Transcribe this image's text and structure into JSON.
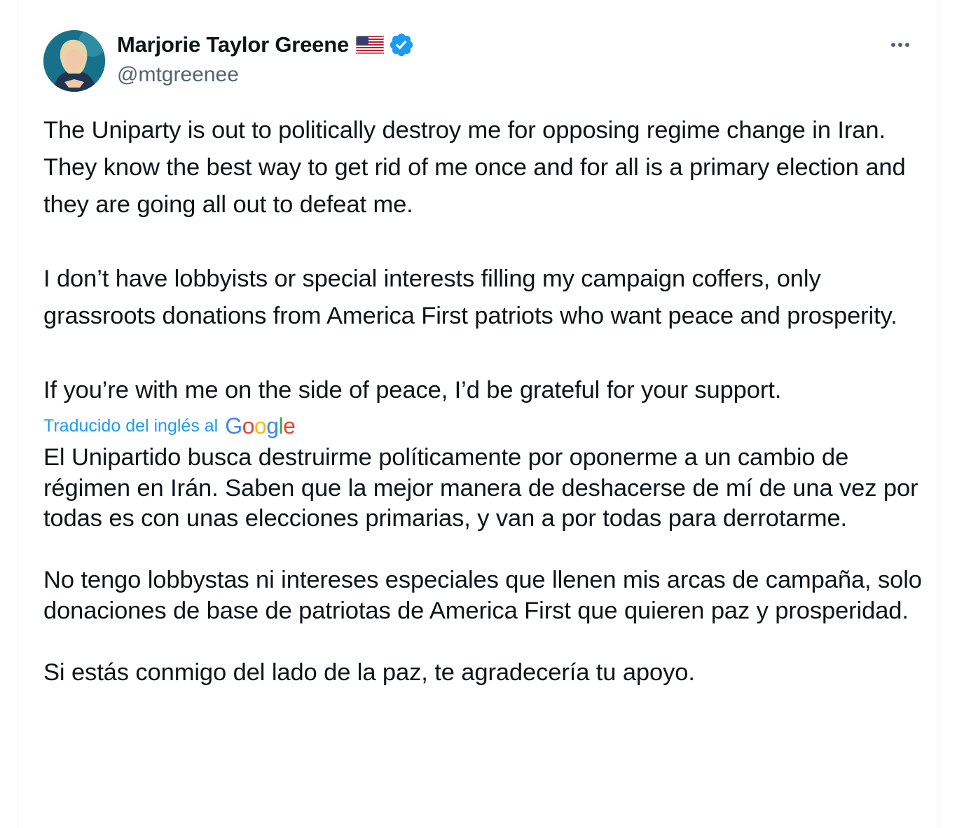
{
  "tweet": {
    "author": {
      "display_name": "Marjorie Taylor Greene",
      "handle": "@mtgreenee",
      "flag_icon": "us-flag-emoji",
      "verified_icon": "verified-badge-icon"
    },
    "more_icon": "more-dots-icon",
    "original_paragraphs": [
      "The Uniparty is out to politically destroy me for opposing regime change in Iran. They know the best way to get rid of me once and for all is a primary election and they are going all out to defeat me.",
      "I don’t have lobbyists or special interests filling my campaign coffers, only grassroots donations from America First patriots who want peace and prosperity.",
      "If you’re with me on the side of peace, I’d be grateful for your support."
    ],
    "translation": {
      "label": "Traducido del inglés al",
      "provider": "Google",
      "paragraphs": [
        "El Unipartido busca destruirme políticamente por oponerme a un cambio de régimen en Irán. Saben que la mejor manera de deshacerse de mí de una vez por todas es con unas elecciones primarias, y van a por todas para derrotarme.",
        "No tengo lobbystas ni intereses especiales que llenen mis arcas de campaña, solo donaciones de base de patriotas de America First que quieren paz y prosperidad.",
        "Si estás conmigo del lado de la paz, te agradecería tu apoyo."
      ]
    },
    "colors": {
      "text": "#0f1419",
      "secondary": "#536471",
      "link": "#1d9bf0",
      "verified": "#1d9bf0",
      "google_blue": "#4285f4",
      "google_red": "#ea4335",
      "google_yellow": "#fbbc05",
      "google_green": "#34a853"
    }
  }
}
